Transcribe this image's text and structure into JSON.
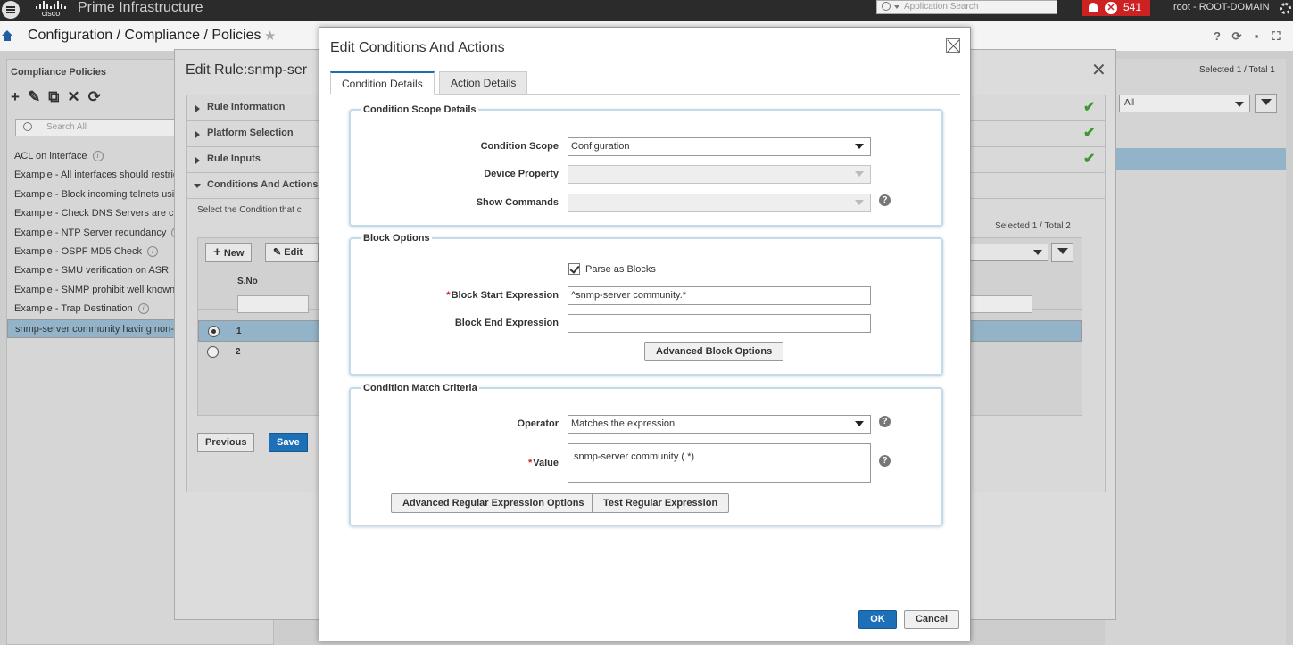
{
  "topbar": {
    "logo_text": "cisco",
    "product": "Prime Infrastructure",
    "search_placeholder": "Application Search",
    "alarm_count": "541",
    "user": "root - ROOT-DOMAIN"
  },
  "breadcrumb": {
    "title": "Configuration / Compliance / Policies"
  },
  "left_panel": {
    "title": "Compliance Policies",
    "search_placeholder": "Search All",
    "items": [
      {
        "label": "ACL on interface",
        "info": true
      },
      {
        "label": "Example - All interfaces should restrict"
      },
      {
        "label": "Example - Block incoming telnets usin"
      },
      {
        "label": "Example - Check DNS Servers are co"
      },
      {
        "label": "Example - NTP Server redundancy",
        "info": true
      },
      {
        "label": "Example - OSPF MD5 Check",
        "info": true
      },
      {
        "label": "Example - SMU verification on ASR",
        "info": true
      },
      {
        "label": "Example - SNMP prohibit well known c"
      },
      {
        "label": "Example - Trap Destination",
        "info": true
      },
      {
        "label": "snmp-server community having non-s",
        "selected": true
      }
    ]
  },
  "right_bg": {
    "selected_total": "Selected 1 / Total 1",
    "filter_value": "All"
  },
  "edit_rule": {
    "title": "Edit Rule:snmp-ser",
    "sections": [
      {
        "label": "Rule Information",
        "done": true
      },
      {
        "label": "Platform Selection",
        "done": true
      },
      {
        "label": "Rule Inputs",
        "done": true
      },
      {
        "label": "Conditions And Actions",
        "open": true
      }
    ],
    "description": "Select the Condition that c",
    "selected_total": "Selected 1 / Total 2",
    "new_label": "New",
    "edit_label": "Edit",
    "column_sno": "S.No",
    "rows": [
      "1",
      "2"
    ],
    "previous_label": "Previous",
    "save_label": "Save"
  },
  "modal": {
    "title": "Edit Conditions And Actions",
    "tabs": [
      "Condition Details",
      "Action Details"
    ],
    "scope": {
      "legend": "Condition Scope Details",
      "condition_scope_label": "Condition Scope",
      "condition_scope_value": "Configuration",
      "device_property_label": "Device Property",
      "device_property_value": "",
      "show_commands_label": "Show Commands",
      "show_commands_value": ""
    },
    "block": {
      "legend": "Block Options",
      "parse_label": "Parse as Blocks",
      "parse_checked": true,
      "start_label": "Block Start Expression",
      "start_value": "^snmp-server community.*",
      "end_label": "Block End Expression",
      "end_value": "",
      "advanced_label": "Advanced Block Options"
    },
    "match": {
      "legend": "Condition Match Criteria",
      "operator_label": "Operator",
      "operator_value": "Matches the expression",
      "value_label": "Value",
      "value_text": "snmp-server community (.*)",
      "adv_regex_label": "Advanced Regular Expression Options",
      "test_regex_label": "Test Regular Expression"
    },
    "ok_label": "OK",
    "cancel_label": "Cancel"
  },
  "icons": {
    "menu": "menu-icon",
    "home": "home-icon",
    "star": "star-icon",
    "help": "question-icon",
    "check": "checkmark-icon"
  }
}
